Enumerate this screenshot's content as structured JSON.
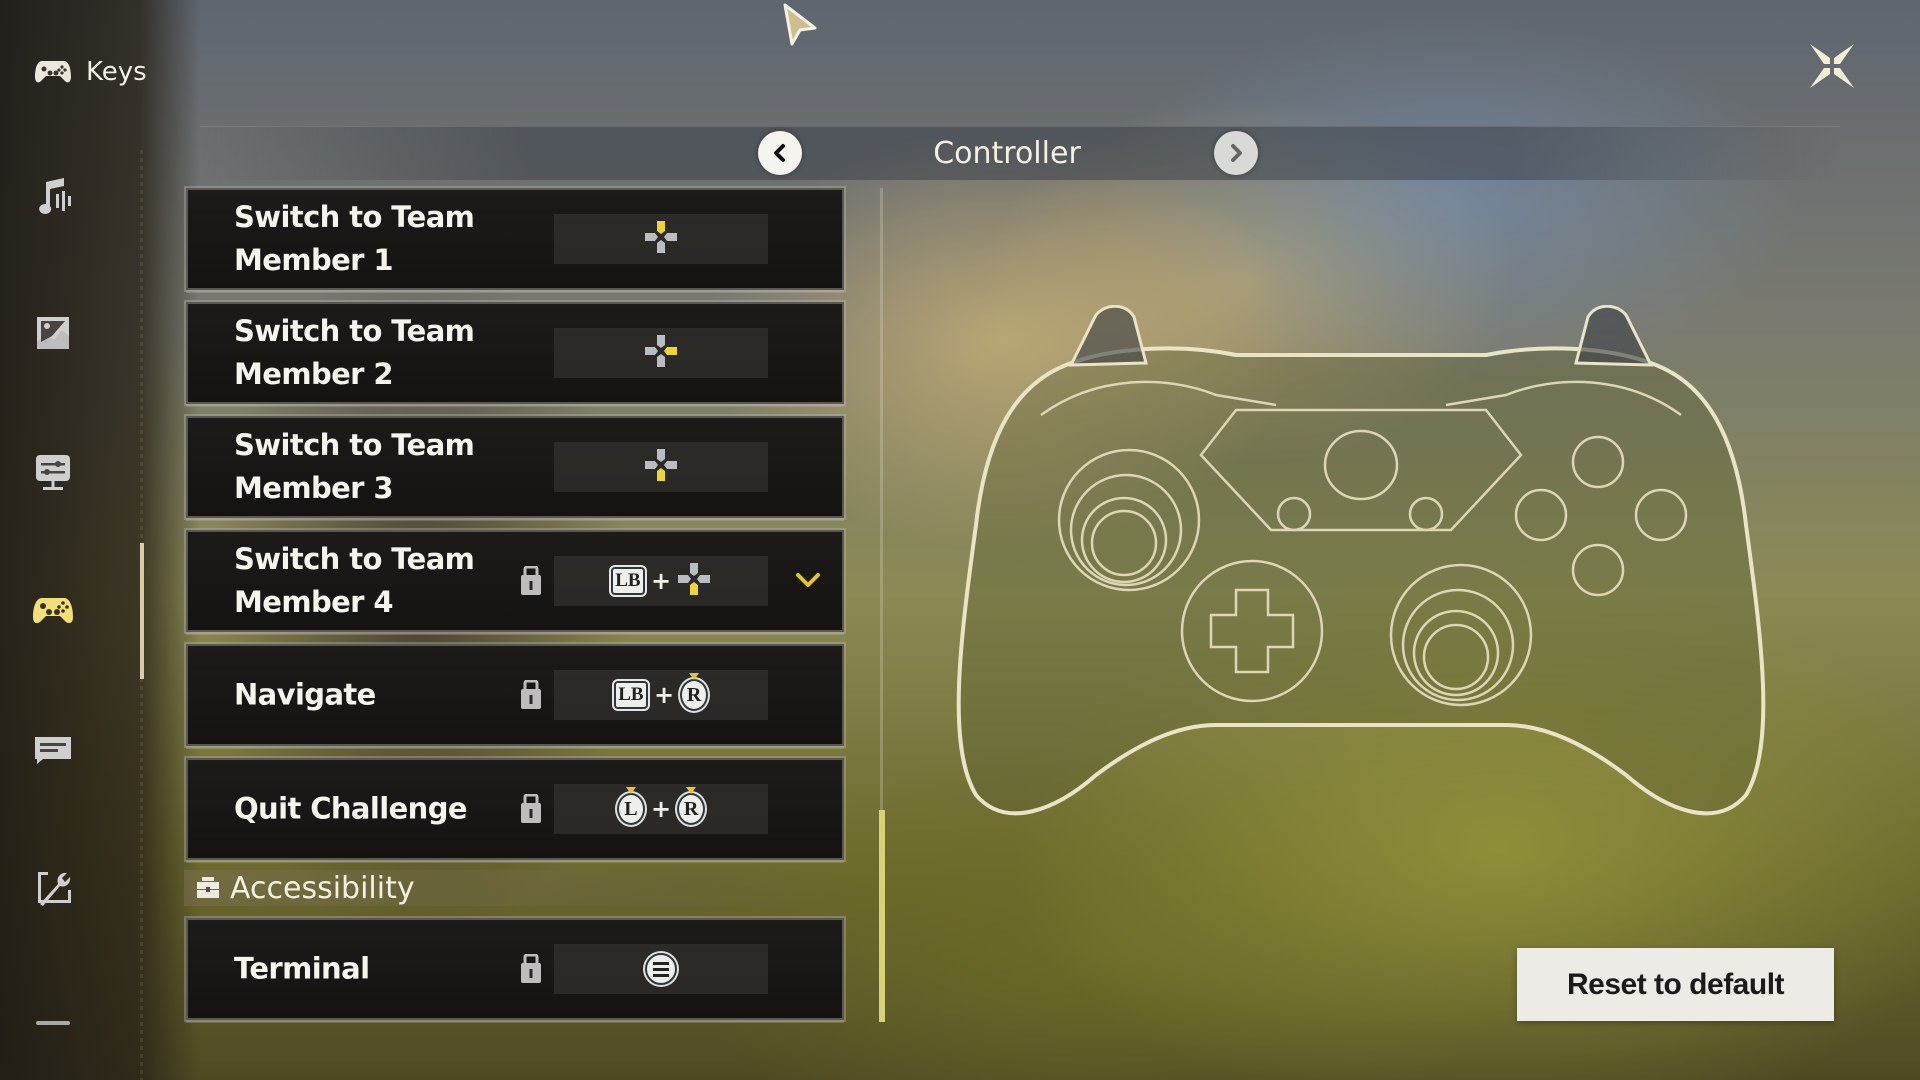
{
  "sidebar": {
    "header": {
      "title": "Keys",
      "icon": "gamepad-icon"
    },
    "items": [
      {
        "name": "audio",
        "icon": "music-icon",
        "active": false
      },
      {
        "name": "graphics",
        "icon": "image-icon",
        "active": false
      },
      {
        "name": "display",
        "icon": "display-settings-icon",
        "active": false
      },
      {
        "name": "controls",
        "icon": "gamepad-icon",
        "active": true
      },
      {
        "name": "language",
        "icon": "chat-icon",
        "active": false
      },
      {
        "name": "other",
        "icon": "wrench-icon",
        "active": false
      },
      {
        "name": "more",
        "icon": "dash-icon",
        "active": false
      }
    ],
    "active_color": "#f0df7a"
  },
  "header": {
    "title": "Controller",
    "prev_icon": "chevron-left-icon",
    "next_icon": "chevron-right-icon",
    "close_icon": "close-icon"
  },
  "bindings": [
    {
      "label": "Switch to Team\nMember 1",
      "locked": false,
      "keys": [
        {
          "type": "dpad",
          "dir": "up"
        }
      ],
      "expandable": false
    },
    {
      "label": "Switch to Team\nMember 2",
      "locked": false,
      "keys": [
        {
          "type": "dpad",
          "dir": "right"
        }
      ],
      "expandable": false
    },
    {
      "label": "Switch to Team\nMember 3",
      "locked": false,
      "keys": [
        {
          "type": "dpad",
          "dir": "down"
        }
      ],
      "expandable": false
    },
    {
      "label": "Switch to Team\nMember 4",
      "locked": true,
      "keys": [
        {
          "type": "button",
          "text": "LB"
        },
        {
          "type": "plus",
          "text": "+"
        },
        {
          "type": "dpad",
          "dir": "down"
        }
      ],
      "expandable": true
    },
    {
      "label": "Navigate",
      "locked": true,
      "keys": [
        {
          "type": "button",
          "text": "LB"
        },
        {
          "type": "plus",
          "text": "+"
        },
        {
          "type": "stick",
          "text": "R"
        }
      ],
      "expandable": false
    },
    {
      "label": "Quit Challenge",
      "locked": true,
      "keys": [
        {
          "type": "stick",
          "text": "L"
        },
        {
          "type": "plus",
          "text": "+"
        },
        {
          "type": "stick",
          "text": "R"
        }
      ],
      "expandable": false
    }
  ],
  "accessibility": {
    "title": "Accessibility",
    "icon": "toolbox-icon",
    "bindings": [
      {
        "label": "Terminal",
        "locked": true,
        "keys": [
          {
            "type": "menu"
          }
        ]
      }
    ]
  },
  "scroll": {
    "position_fraction": 1.0
  },
  "actions": {
    "reset_label": "Reset to default"
  },
  "colors": {
    "accent": "#e6c23a",
    "dpad_highlight": "#f0d23c",
    "scroll_thumb": "#d9d07a"
  }
}
